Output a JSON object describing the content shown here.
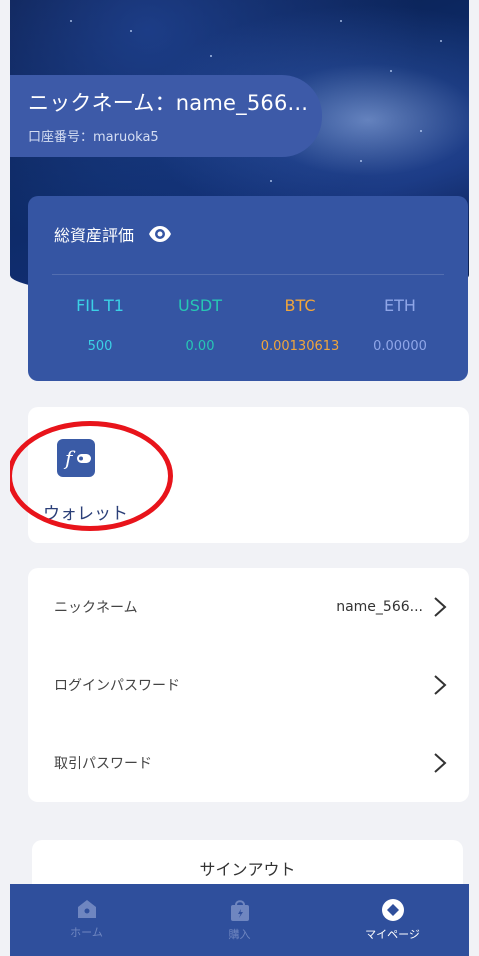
{
  "profile": {
    "nickname_line": "ニックネーム：name_566...",
    "account_line": "口座番号：maruoka5"
  },
  "assets": {
    "title": "総資産評価",
    "coins": [
      {
        "symbol": "FIL T1",
        "value": "500",
        "color": "#3bd1e6"
      },
      {
        "symbol": "USDT",
        "value": "0.00",
        "color": "#27c7b4"
      },
      {
        "symbol": "BTC",
        "value": "0.00130613",
        "color": "#f0a53c"
      },
      {
        "symbol": "ETH",
        "value": "0.00000",
        "color": "#8fa6e8"
      }
    ]
  },
  "wallet": {
    "label": "ウォレット"
  },
  "settings": {
    "rows": [
      {
        "label": "ニックネーム",
        "value": "name_566..."
      },
      {
        "label": "ログインパスワード",
        "value": ""
      },
      {
        "label": "取引パスワード",
        "value": ""
      }
    ]
  },
  "signout": {
    "label": "サインアウト"
  },
  "tabbar": {
    "tabs": [
      {
        "label": "ホーム",
        "icon": "home-icon"
      },
      {
        "label": "購入",
        "icon": "bag-icon"
      },
      {
        "label": "マイページ",
        "icon": "mypage-icon"
      }
    ]
  },
  "colors": {
    "primary": "#3555a3",
    "highlight_ring": "#e8141b"
  }
}
